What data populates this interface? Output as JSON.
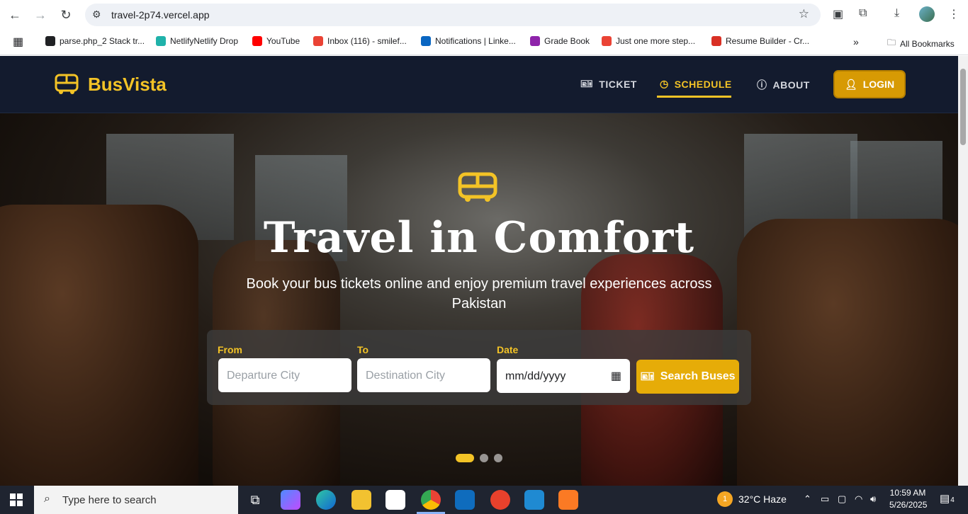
{
  "browser": {
    "url": "travel-2p74.vercel.app",
    "bookmarks": [
      {
        "label": "parse.php_2 Stack tr...",
        "color": "#202124"
      },
      {
        "label": "NetlifyNetlify Drop",
        "color": "#20b2aa"
      },
      {
        "label": "YouTube",
        "color": "#ff0000"
      },
      {
        "label": "Inbox (116) - smilef...",
        "color": "#ea4335"
      },
      {
        "label": "Notifications | Linke...",
        "color": "#0a66c2"
      },
      {
        "label": "Grade Book",
        "color": "#8e24aa"
      },
      {
        "label": "Just one more step...",
        "color": "#ea4335"
      },
      {
        "label": "Resume Builder - Cr...",
        "color": "#d93025"
      }
    ],
    "all_bookmarks": "All Bookmarks"
  },
  "site": {
    "brand": "BusVista",
    "nav": {
      "ticket": "TICKET",
      "schedule": "SCHEDULE",
      "about": "ABOUT",
      "login": "LOGIN"
    },
    "accent": "#f3c326",
    "hero": {
      "title": "Travel in Comfort",
      "subtitle": "Book your bus tickets online and enjoy premium travel experiences across Pakistan"
    },
    "search": {
      "from_label": "From",
      "from_placeholder": "Departure City",
      "to_label": "To",
      "to_placeholder": "Destination City",
      "date_label": "Date",
      "date_value": "mm/dd/yyyy",
      "button": "Search Buses"
    },
    "slides": {
      "count": 3,
      "active": 1
    }
  },
  "taskbar": {
    "search_placeholder": "Type here to search",
    "weather": "32°C  Haze",
    "weather_badge": "1",
    "time": "10:59 AM",
    "date": "5/26/2025",
    "notifications": "4"
  }
}
